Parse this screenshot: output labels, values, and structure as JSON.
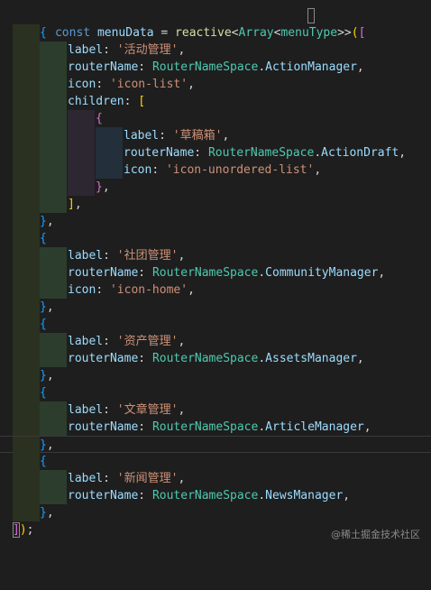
{
  "code": {
    "const_kw": "const",
    "var_name": "menuData",
    "eq": "=",
    "fn": "reactive",
    "type_array": "Array",
    "type_menu": "menuType",
    "open_tail": ">>([",
    "k_label": "label",
    "k_router": "routerName",
    "k_icon": "icon",
    "k_children": "children",
    "ns": "RouterNameSpace",
    "items": [
      {
        "label": "'活动管理'",
        "router": "ActionManager",
        "icon": "'icon-list'",
        "children": [
          {
            "label": "'草稿箱'",
            "router": "ActionDraft",
            "icon": "'icon-unordered-list'"
          }
        ]
      },
      {
        "label": "'社团管理'",
        "router": "CommunityManager",
        "icon": "'icon-home'"
      },
      {
        "label": "'资产管理'",
        "router": "AssetsManager"
      },
      {
        "label": "'文章管理'",
        "router": "ArticleManager"
      },
      {
        "label": "'新闻管理'",
        "router": "NewsManager"
      }
    ],
    "end": "]);"
  },
  "watermark": "@稀土掘金技术社区"
}
